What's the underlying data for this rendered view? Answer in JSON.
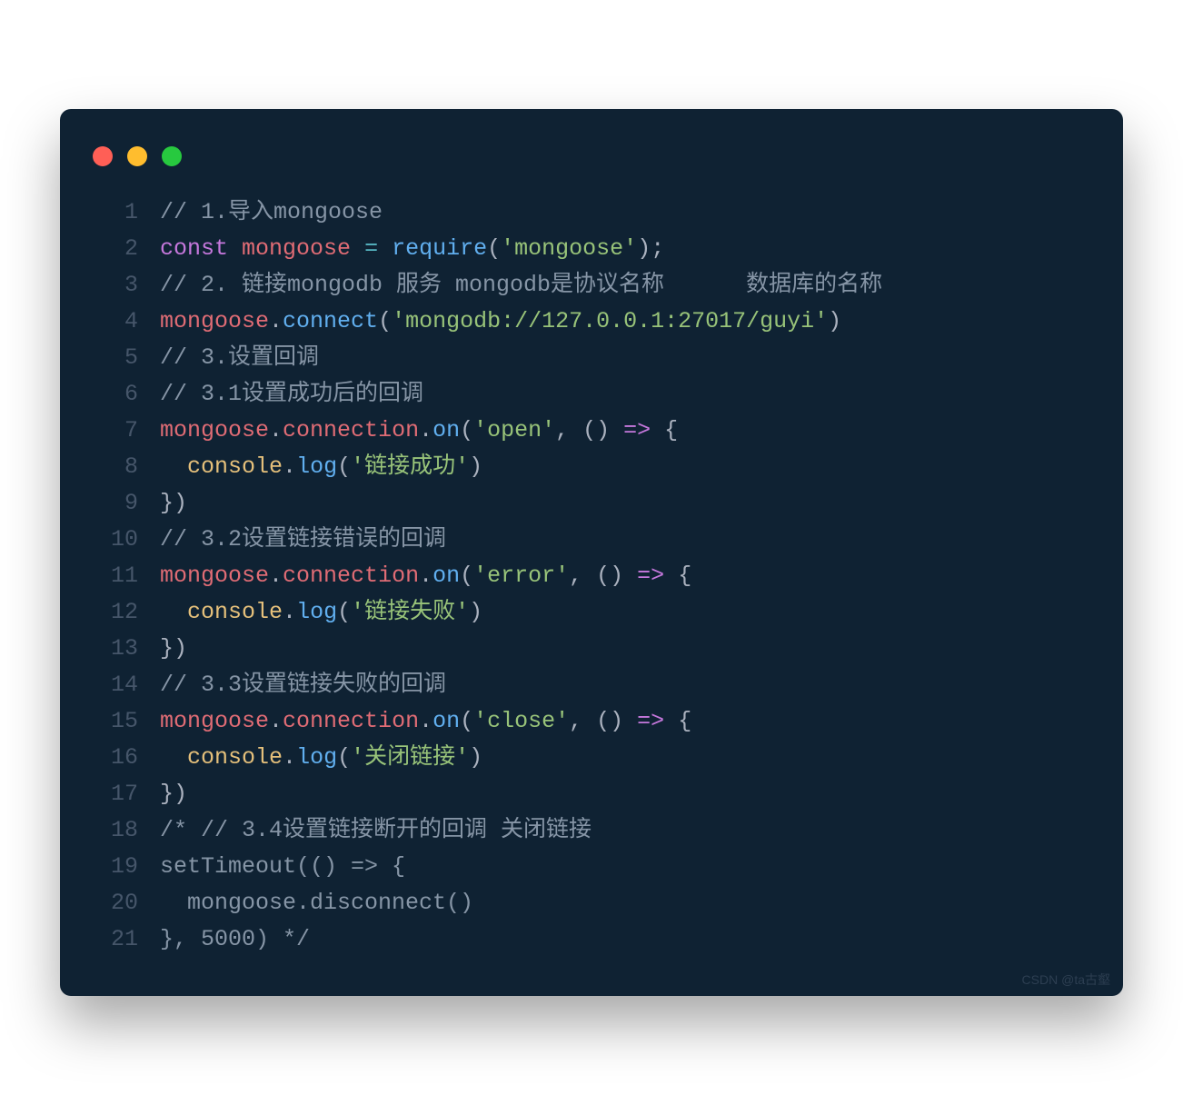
{
  "window": {
    "dots": [
      "red",
      "yellow",
      "green"
    ]
  },
  "code": {
    "lines": [
      {
        "n": "1",
        "tokens": [
          {
            "c": "tok-comment",
            "t": "// 1.导入mongoose"
          }
        ]
      },
      {
        "n": "2",
        "tokens": [
          {
            "c": "tok-kw",
            "t": "const"
          },
          {
            "c": "tok-plain",
            "t": " "
          },
          {
            "c": "tok-ident",
            "t": "mongoose"
          },
          {
            "c": "tok-plain",
            "t": " "
          },
          {
            "c": "tok-op",
            "t": "="
          },
          {
            "c": "tok-plain",
            "t": " "
          },
          {
            "c": "tok-fn",
            "t": "require"
          },
          {
            "c": "tok-plain",
            "t": "("
          },
          {
            "c": "tok-str",
            "t": "'mongoose'"
          },
          {
            "c": "tok-plain",
            "t": ");"
          }
        ]
      },
      {
        "n": "3",
        "tokens": [
          {
            "c": "tok-comment",
            "t": "// 2. 链接mongodb 服务 mongodb是协议名称      数据库的名称"
          }
        ]
      },
      {
        "n": "4",
        "tokens": [
          {
            "c": "tok-ident",
            "t": "mongoose"
          },
          {
            "c": "tok-plain",
            "t": "."
          },
          {
            "c": "tok-fn",
            "t": "connect"
          },
          {
            "c": "tok-plain",
            "t": "("
          },
          {
            "c": "tok-str",
            "t": "'mongodb://127.0.0.1:27017/guyi'"
          },
          {
            "c": "tok-plain",
            "t": ")"
          }
        ]
      },
      {
        "n": "5",
        "tokens": [
          {
            "c": "tok-comment",
            "t": "// 3.设置回调"
          }
        ]
      },
      {
        "n": "6",
        "tokens": [
          {
            "c": "tok-comment",
            "t": "// 3.1设置成功后的回调"
          }
        ]
      },
      {
        "n": "7",
        "tokens": [
          {
            "c": "tok-ident",
            "t": "mongoose"
          },
          {
            "c": "tok-plain",
            "t": "."
          },
          {
            "c": "tok-ident",
            "t": "connection"
          },
          {
            "c": "tok-plain",
            "t": "."
          },
          {
            "c": "tok-fn",
            "t": "on"
          },
          {
            "c": "tok-plain",
            "t": "("
          },
          {
            "c": "tok-str",
            "t": "'open'"
          },
          {
            "c": "tok-plain",
            "t": ", () "
          },
          {
            "c": "tok-kw",
            "t": "=>"
          },
          {
            "c": "tok-plain",
            "t": " {"
          }
        ]
      },
      {
        "n": "8",
        "tokens": [
          {
            "c": "tok-plain",
            "t": "  "
          },
          {
            "c": "tok-obj",
            "t": "console"
          },
          {
            "c": "tok-plain",
            "t": "."
          },
          {
            "c": "tok-fn",
            "t": "log"
          },
          {
            "c": "tok-plain",
            "t": "("
          },
          {
            "c": "tok-str",
            "t": "'链接成功'"
          },
          {
            "c": "tok-plain",
            "t": ")"
          }
        ]
      },
      {
        "n": "9",
        "tokens": [
          {
            "c": "tok-plain",
            "t": "})"
          }
        ]
      },
      {
        "n": "10",
        "tokens": [
          {
            "c": "tok-comment",
            "t": "// 3.2设置链接错误的回调"
          }
        ]
      },
      {
        "n": "11",
        "tokens": [
          {
            "c": "tok-ident",
            "t": "mongoose"
          },
          {
            "c": "tok-plain",
            "t": "."
          },
          {
            "c": "tok-ident",
            "t": "connection"
          },
          {
            "c": "tok-plain",
            "t": "."
          },
          {
            "c": "tok-fn",
            "t": "on"
          },
          {
            "c": "tok-plain",
            "t": "("
          },
          {
            "c": "tok-str",
            "t": "'error'"
          },
          {
            "c": "tok-plain",
            "t": ", () "
          },
          {
            "c": "tok-kw",
            "t": "=>"
          },
          {
            "c": "tok-plain",
            "t": " {"
          }
        ]
      },
      {
        "n": "12",
        "tokens": [
          {
            "c": "tok-plain",
            "t": "  "
          },
          {
            "c": "tok-obj",
            "t": "console"
          },
          {
            "c": "tok-plain",
            "t": "."
          },
          {
            "c": "tok-fn",
            "t": "log"
          },
          {
            "c": "tok-plain",
            "t": "("
          },
          {
            "c": "tok-str",
            "t": "'链接失败'"
          },
          {
            "c": "tok-plain",
            "t": ")"
          }
        ]
      },
      {
        "n": "13",
        "tokens": [
          {
            "c": "tok-plain",
            "t": "})"
          }
        ]
      },
      {
        "n": "14",
        "tokens": [
          {
            "c": "tok-comment",
            "t": "// 3.3设置链接失败的回调"
          }
        ]
      },
      {
        "n": "15",
        "tokens": [
          {
            "c": "tok-ident",
            "t": "mongoose"
          },
          {
            "c": "tok-plain",
            "t": "."
          },
          {
            "c": "tok-ident",
            "t": "connection"
          },
          {
            "c": "tok-plain",
            "t": "."
          },
          {
            "c": "tok-fn",
            "t": "on"
          },
          {
            "c": "tok-plain",
            "t": "("
          },
          {
            "c": "tok-str",
            "t": "'close'"
          },
          {
            "c": "tok-plain",
            "t": ", () "
          },
          {
            "c": "tok-kw",
            "t": "=>"
          },
          {
            "c": "tok-plain",
            "t": " {"
          }
        ]
      },
      {
        "n": "16",
        "tokens": [
          {
            "c": "tok-plain",
            "t": "  "
          },
          {
            "c": "tok-obj",
            "t": "console"
          },
          {
            "c": "tok-plain",
            "t": "."
          },
          {
            "c": "tok-fn",
            "t": "log"
          },
          {
            "c": "tok-plain",
            "t": "("
          },
          {
            "c": "tok-str",
            "t": "'关闭链接'"
          },
          {
            "c": "tok-plain",
            "t": ")"
          }
        ]
      },
      {
        "n": "17",
        "tokens": [
          {
            "c": "tok-plain",
            "t": "})"
          }
        ]
      },
      {
        "n": "18",
        "tokens": [
          {
            "c": "tok-comment",
            "t": "/* // 3.4设置链接断开的回调 关闭链接"
          }
        ]
      },
      {
        "n": "19",
        "tokens": [
          {
            "c": "tok-comment",
            "t": "setTimeout(() => {"
          }
        ]
      },
      {
        "n": "20",
        "tokens": [
          {
            "c": "tok-comment",
            "t": "  mongoose.disconnect()"
          }
        ]
      },
      {
        "n": "21",
        "tokens": [
          {
            "c": "tok-comment",
            "t": "}, 5000) */"
          }
        ]
      }
    ]
  },
  "watermark": "CSDN @ta古壑"
}
